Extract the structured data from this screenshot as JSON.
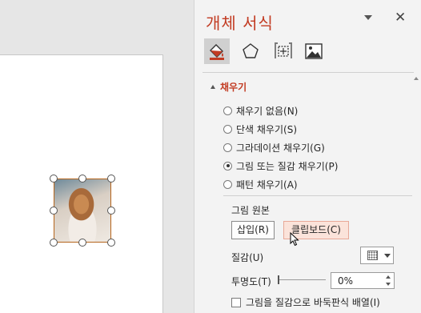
{
  "pane": {
    "title": "개체 서식",
    "tabs": [
      {
        "name": "fill-line",
        "icon": "paint-bucket-icon"
      },
      {
        "name": "effects",
        "icon": "pentagon-icon"
      },
      {
        "name": "size-properties",
        "icon": "size-position-icon"
      },
      {
        "name": "picture",
        "icon": "picture-icon"
      }
    ],
    "active_tab": "fill-line"
  },
  "fill": {
    "section_title": "채우기",
    "options": [
      {
        "label": "채우기 없음(N)",
        "checked": false
      },
      {
        "label": "단색 채우기(S)",
        "checked": false
      },
      {
        "label": "그라데이션 채우기(G)",
        "checked": false
      },
      {
        "label": "그림 또는 질감 채우기(P)",
        "checked": true
      },
      {
        "label": "패턴 채우기(A)",
        "checked": false
      }
    ],
    "picture_source_label": "그림 원본",
    "insert_label": "삽입(R)",
    "clipboard_label": "클립보드(C)",
    "texture_label": "질감(U)",
    "transparency_label": "투명도(T)",
    "transparency_value": "0%",
    "tile_label": "그림을 질감으로 바둑판식 배열(I)",
    "tile_checked": false
  },
  "colors": {
    "accent": "#c23b22",
    "pane_background": "#f3f3f3",
    "hover_button": "#fbe3da"
  }
}
